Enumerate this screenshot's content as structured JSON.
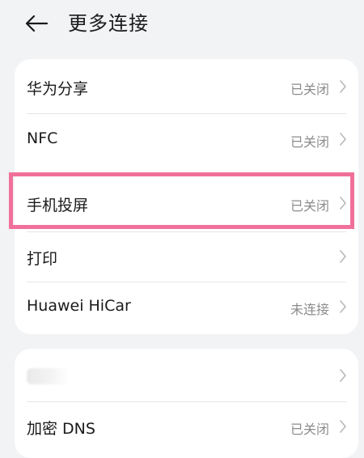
{
  "header": {
    "title": "更多连接",
    "back_icon": "arrow-left-icon"
  },
  "group1": {
    "items": [
      {
        "label": "华为分享",
        "value": "已关闭"
      },
      {
        "label": "NFC",
        "value": "已关闭"
      },
      {
        "label": "手机投屏",
        "value": "已关闭"
      },
      {
        "label": "打印",
        "value": ""
      },
      {
        "label": "Huawei HiCar",
        "value": "未连接"
      }
    ]
  },
  "group2": {
    "items": [
      {
        "label": "",
        "value": ""
      },
      {
        "label": "加密 DNS",
        "value": "已关闭"
      }
    ]
  },
  "colors": {
    "highlight": "#f0709a",
    "background": "#f1f3f5",
    "card": "#ffffff"
  }
}
